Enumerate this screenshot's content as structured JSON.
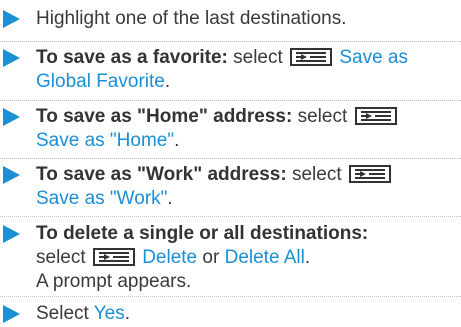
{
  "steps": [
    {
      "text": "Highlight one of the last destinations."
    },
    {
      "bold": "To save as a favorite:",
      "select_word": "select",
      "action_line1": "Save as",
      "action_line2": "Global Favorite",
      "end": "."
    },
    {
      "bold": "To save as \"Home\" address:",
      "select_word": "select",
      "action": "Save as \"Home\"",
      "end": "."
    },
    {
      "bold": "To save as \"Work\" address:",
      "select_word": "select",
      "action": "Save as \"Work\"",
      "end": "."
    },
    {
      "bold": "To delete a single or all destinations:",
      "select_word": "select",
      "action1": "Delete",
      "or_word": "or",
      "action2": "Delete All",
      "end": ".",
      "note": "A prompt appears."
    },
    {
      "prefix": "Select",
      "action": "Yes",
      "end": "."
    }
  ],
  "colors": {
    "accent": "#1a8fd6",
    "text": "#3a3a3a"
  },
  "icons": {
    "bullet": "triangle-right-arrow",
    "menu": "list-menu-icon"
  }
}
